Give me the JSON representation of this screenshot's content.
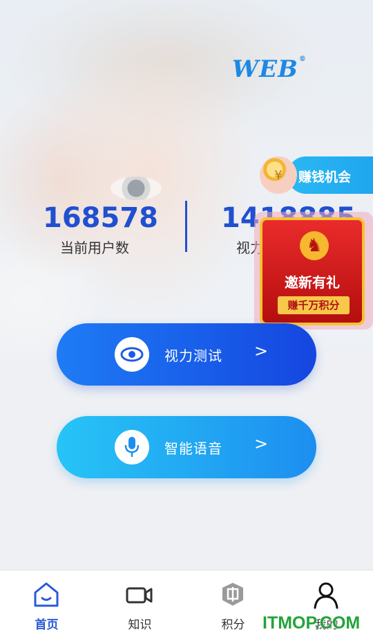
{
  "header": {
    "logo_text": "WEB",
    "logo_mark": "®"
  },
  "earn_banner": {
    "label": "赚钱机会",
    "icon": "coin-hand-icon"
  },
  "stats": {
    "current_users": {
      "value": "168578",
      "label": "当前用户数"
    },
    "vision": {
      "value": "1418885",
      "label": "视力"
    }
  },
  "invite_popup": {
    "title": "邀新有礼",
    "subtitle": "赚千万积分",
    "icon": "horse-icon"
  },
  "actions": {
    "vision_test": {
      "label": "视力测试",
      "arrow": ">"
    },
    "smart_voice": {
      "label": "智能语音",
      "arrow": ">"
    }
  },
  "tabbar": {
    "items": [
      {
        "label": "首页",
        "icon": "home-icon",
        "active": true
      },
      {
        "label": "知识",
        "icon": "video-icon",
        "active": false
      },
      {
        "label": "积分",
        "icon": "points-icon",
        "active": false
      },
      {
        "label": "我的",
        "icon": "user-icon",
        "active": false
      }
    ]
  },
  "watermark": "ITMOP.COM",
  "colors": {
    "accent": "#2050cf",
    "tab_active": "#2a5ad8",
    "popup_red": "#d41c1c"
  }
}
